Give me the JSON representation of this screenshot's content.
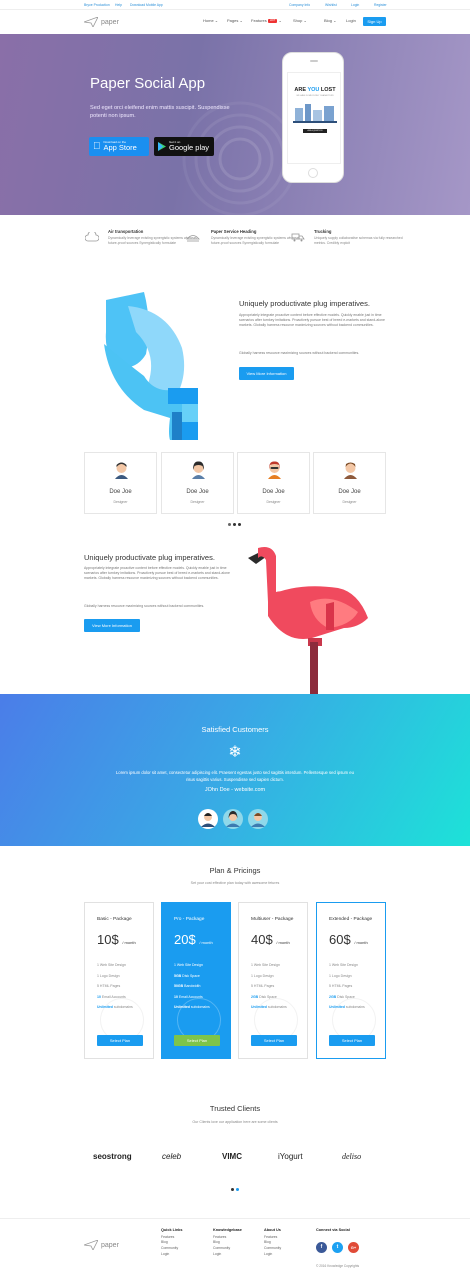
{
  "topbar": {
    "left": [
      "Bryce Production",
      "Help",
      "Download Mobile App"
    ],
    "right": [
      "Company Info",
      "Wishlist",
      "Login",
      "Register"
    ]
  },
  "nav": {
    "logo_text": "paper",
    "menu": [
      "Home",
      "Pages",
      "Features",
      "Shop",
      "Blog",
      "Login"
    ],
    "hot_badge": "HOT",
    "signup": "Sign Up"
  },
  "hero": {
    "title": "Paper Social App",
    "subtitle": "Sed eget orci eleifend enim mattis suscipit. Suspendisse potenti non ipsum.",
    "appstore": {
      "small": "Download on the",
      "big": "App Store"
    },
    "googleplay": {
      "small": "Get it on",
      "big": "Google play"
    },
    "phone": {
      "headline_pre": "ARE ",
      "headline_em": "YOU",
      "headline_post": " LOST",
      "sub": "WE HAVE SOME FUNNY CHARACTERS",
      "btn": "ASK A QUESTION"
    }
  },
  "features": [
    {
      "title": "Air transportation",
      "text": "Dynamically leverage existing synergistic systems whereas future-proof sources Synergistically formulate",
      "icon": "cloud-icon"
    },
    {
      "title": "Paper Service Heading",
      "text": "Dynamically leverage existing synergistic systems whereas future-proof sources Synergistically formulate",
      "icon": "plane-icon"
    },
    {
      "title": "Trucking",
      "text": "Uniquely supply collaborative schemas via fully researched metrics. Credibly exploit",
      "icon": "truck-icon"
    }
  ],
  "section1": {
    "title": "Uniquely productivate plug imperatives.",
    "text1": "Appropriately integrate proactive content before effective models. Quickly enable just in time scenarios after turnkey imitations. Proactively pursue best of breed e-markets and stand-alone markets. Globally harness resource maximizing sources without backend communities.",
    "text2": "Globally harness resource maximizing sources without backend communities.",
    "button": "View More Information"
  },
  "team": [
    {
      "name": "Doe Joe",
      "role": "Designer"
    },
    {
      "name": "Doe Joe",
      "role": "Designer"
    },
    {
      "name": "Doe Joe",
      "role": "Designer"
    },
    {
      "name": "Doe Joe",
      "role": "Designer"
    }
  ],
  "section2": {
    "title": "Uniquely productivate plug imperatives.",
    "text1": "Appropriately integrate proactive content before effective models. Quickly enable just in time scenarios after turnkey imitations. Proactively pursue best of breed e-markets and stand-alone markets. Globally harness resource maximizing sources without backend communities.",
    "text2": "Globally harness resource maximizing sources without backend communities.",
    "button": "View More Information"
  },
  "testimonial": {
    "title": "Satisfied Customers",
    "quote": "Lorem ipsum dolor sit amet, consectetur adipiscing elit. Praesent egestas justo sed sagittis interdum. Pellentesque sed ipsum eu risus sagittis varius. Suspendisse sed sapien dictum.",
    "author": "JOhn Doe - website.com"
  },
  "pricing": {
    "title": "Plan & Pricings",
    "subtitle": "Set your cost effective plan today with awesome fetures",
    "plans": [
      {
        "name": "Basic - Package",
        "price": "10$",
        "per": "/ month",
        "f1": "1 Web Site Design",
        "f2": "1 Logo Design",
        "f3": "5 HTML Pages",
        "f4b": "10",
        "f4": " Email Accounts",
        "f5b": "Unlimited",
        "f5": " subdomains",
        "btn": "Select Plan"
      },
      {
        "name": "Pro - Package",
        "price": "20$",
        "per": "/ month",
        "f1": "1 Web Site Design",
        "f2b": "5GB",
        "f2": " Disk Space",
        "f3b": "50GB",
        "f3": " Bandwidth",
        "f4b": "10",
        "f4": " Email Accounts",
        "f5b": "Unlimited",
        "f5": " subdomains",
        "btn": "Select Plan"
      },
      {
        "name": "Multiuser - Package",
        "price": "40$",
        "per": "/ month",
        "f1": "1 Web Site Design",
        "f2": "1 Logo Design",
        "f3": "5 HTML Pages",
        "f4b": "2GB",
        "f4": " Disk Space",
        "f5b": "Unlimited",
        "f5": " subdomains",
        "btn": "Select Plan"
      },
      {
        "name": "Extended - Package",
        "price": "60$",
        "per": "/ month",
        "f1": "1 Web Site Design",
        "f2": "1 Logo Design",
        "f3": "5 HTML Pages",
        "f4b": "2GB",
        "f4": " Disk Space",
        "f5b": "Unlimited",
        "f5": " subdomains",
        "btn": "Select Plan"
      }
    ]
  },
  "clients": {
    "title": "Trusted Clients",
    "subtitle": "Our Clients love our application here are some clients",
    "logos": [
      "seostrong",
      "celeb",
      "VIMC",
      "iYogurt",
      "deliso"
    ]
  },
  "footer": {
    "logo_text": "paper",
    "cols": [
      {
        "title": "Quick Links",
        "items": [
          "Features",
          "Blog",
          "Community",
          "Login"
        ]
      },
      {
        "title": "Knowledgebase",
        "items": [
          "Features",
          "Blog",
          "Community",
          "Login"
        ]
      },
      {
        "title": "About Us",
        "items": [
          "Features",
          "Blog",
          "Community",
          "Login"
        ]
      }
    ],
    "social_title": "Connect via Social",
    "social": [
      "f",
      "t",
      "G+"
    ],
    "copyright": "© 2016 Knowledge Copyrights"
  },
  "colors": {
    "accent": "#1a9cf0",
    "green": "#7ec44a",
    "flamingo": "#f04a5e",
    "dolphin": "#4cc3f4"
  }
}
